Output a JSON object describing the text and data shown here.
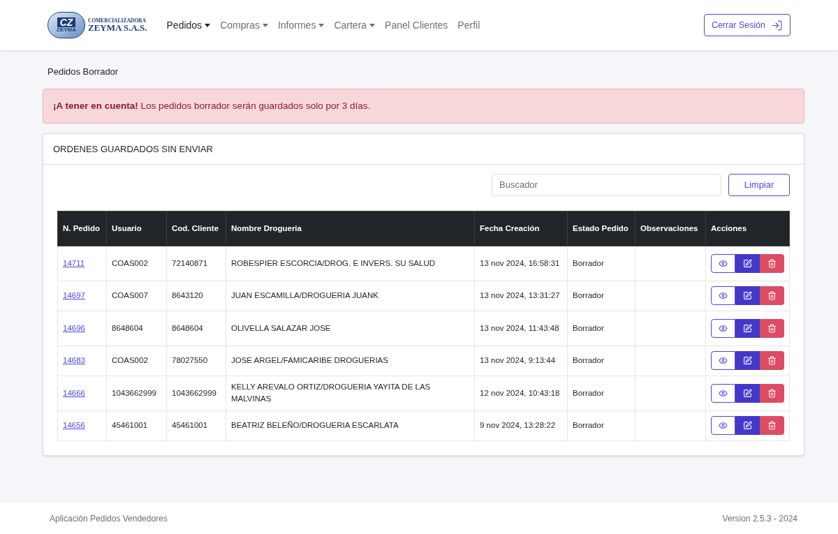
{
  "logo": {
    "mark": "CZ",
    "sub": "ZEYMA",
    "line1": "COMERCIALIZADORA",
    "line2": "ZEYMA S.A.S."
  },
  "nav": [
    {
      "label": "Pedidos",
      "selected": true,
      "dropdown": true
    },
    {
      "label": "Compras",
      "selected": false,
      "dropdown": true
    },
    {
      "label": "Informes",
      "selected": false,
      "dropdown": true
    },
    {
      "label": "Cartera",
      "selected": false,
      "dropdown": true
    },
    {
      "label": "Panel Clientes",
      "selected": false,
      "dropdown": false
    },
    {
      "label": "Perfil",
      "selected": false,
      "dropdown": false
    }
  ],
  "logout_button": "Cerrar Sesión",
  "page_title": "Pedidos Borrador",
  "alert": "**¡A tener en cuenta!** Los pedidos borrador serán guardados solo por 3 días.",
  "card": {
    "title": "ORDENES GUARDADOS SIN ENVIAR",
    "search": {
      "placeholder": "Buscador"
    },
    "clear_button": "Limpiar",
    "table": {
      "columns": [
        "N. Pedido",
        "Usuario",
        "Cod. Cliente",
        "Nombre Drogueria",
        "Fecha Creación",
        "Estado Pedido",
        "Observaciones",
        "Acciones"
      ],
      "rows": [
        {
          "order": "14711",
          "user": "COAS002",
          "client_code": "72140871",
          "name": "ROBESPIER ESCORCIA/DROG. E INVERS. SU SALUD",
          "date": "13 nov 2024, 16:58:31",
          "status": "Borrador"
        },
        {
          "order": "14697",
          "user": "COAS007",
          "client_code": "8643120",
          "name": "JUAN ESCAMILLA/DROGUERIA JUANK",
          "date": "13 nov 2024, 13:31:27",
          "status": "Borrador"
        },
        {
          "order": "14696",
          "user": "8648604",
          "client_code": "8648604",
          "name": "OLIVELLA SALAZAR JOSE",
          "date": "13 nov 2024, 11:43:48",
          "status": "Borrador"
        },
        {
          "order": "14683",
          "user": "COAS002",
          "client_code": "78027550",
          "name": "JOSE ARGEL/FAMICARIBE DROGUERIAS",
          "date": "13 nov 2024, 9:13:44",
          "status": "Borrador"
        },
        {
          "order": "14666",
          "user": "1043662999",
          "client_code": "1043662999",
          "name": "KELLY AREVALO ORTIZ/DROGUERIA YAYITA DE LAS MALVINAS",
          "date": "12 nov 2024, 10:43:18",
          "status": "Borrador"
        },
        {
          "order": "14656",
          "user": "45461001",
          "client_code": "45461001",
          "name": "BEATRIZ BELEÑO/DROGUERIA ESCARLATA",
          "date": "9 nov 2024, 13:28:22",
          "status": "Borrador"
        }
      ]
    }
  },
  "footer": {
    "left": "Aplicación Pedidos Vendedores",
    "right": "Version 2.5.3 - 2024"
  }
}
